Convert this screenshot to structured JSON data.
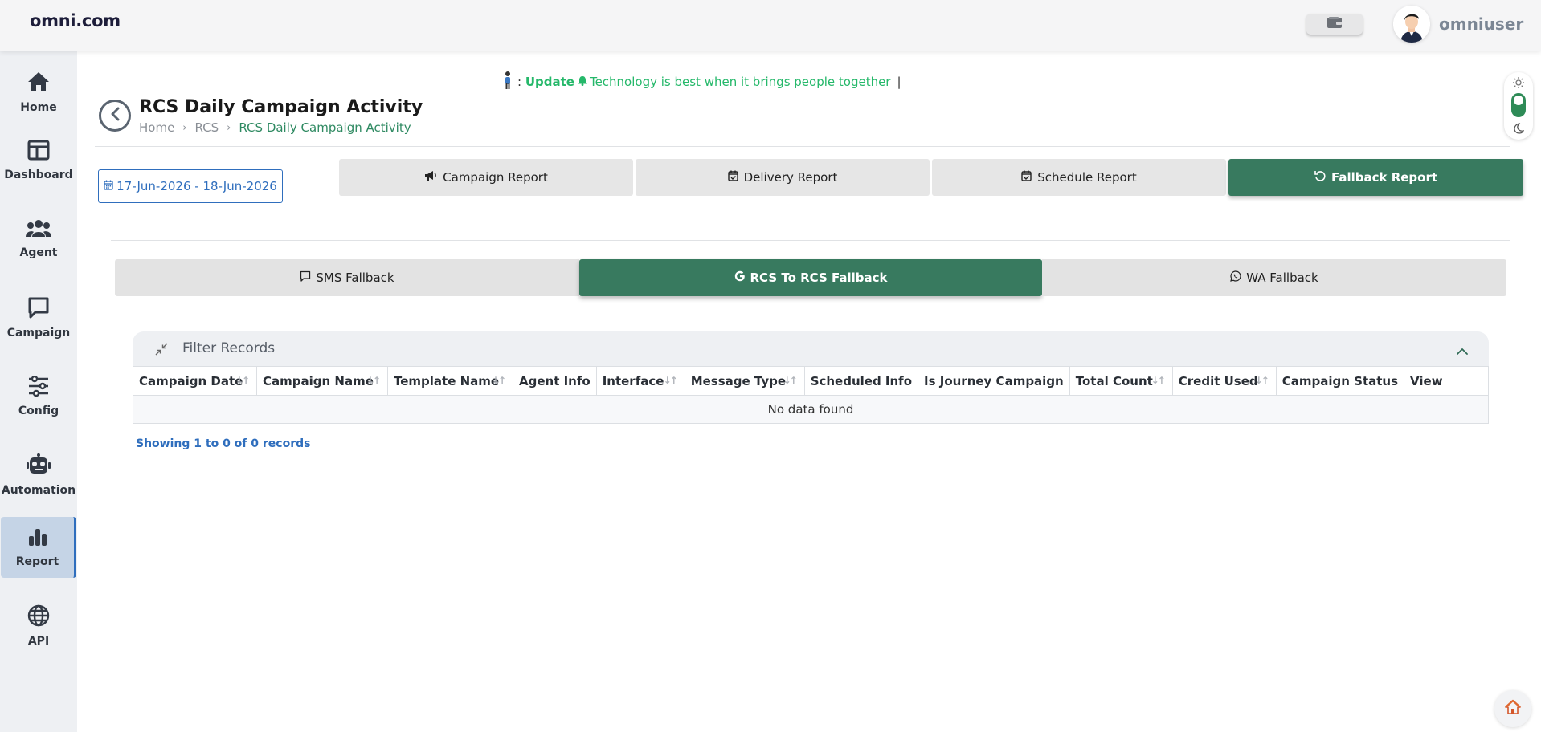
{
  "header": {
    "brand": "omni.com",
    "username": "omniuser"
  },
  "sidebar": {
    "items": [
      {
        "label": "Home",
        "icon": "home-icon"
      },
      {
        "label": "Dashboard",
        "icon": "dashboard-icon"
      },
      {
        "label": "Agent",
        "icon": "users-icon"
      },
      {
        "label": "Campaign",
        "icon": "chat-icon"
      },
      {
        "label": "Config",
        "icon": "sliders-icon"
      },
      {
        "label": "Automation",
        "icon": "robot-icon"
      },
      {
        "label": "Report",
        "icon": "bar-chart-icon",
        "active": true
      },
      {
        "label": "API",
        "icon": "globe-icon"
      }
    ]
  },
  "ticker": {
    "prefix": ": ",
    "update_label": "Update",
    "message": "Technology is best when it brings people together",
    "cursor": "|"
  },
  "page": {
    "title": "RCS Daily Campaign Activity",
    "breadcrumb": [
      "Home",
      "RCS",
      "RCS Daily Campaign Activity"
    ]
  },
  "date_range": "17-Jun-2026 - 18-Jun-2026",
  "report_tabs": [
    {
      "label": "Campaign Report",
      "icon": "megaphone-icon"
    },
    {
      "label": "Delivery Report",
      "icon": "calendar-check-icon"
    },
    {
      "label": "Schedule Report",
      "icon": "calendar-check-icon"
    },
    {
      "label": "Fallback Report",
      "icon": "undo-icon",
      "active": true
    }
  ],
  "fallback_tabs": [
    {
      "label": "SMS Fallback",
      "icon": "message-square-icon"
    },
    {
      "label": "RCS To RCS Fallback",
      "icon": "google-icon",
      "active": true
    },
    {
      "label": "WA Fallback",
      "icon": "whatsapp-icon"
    }
  ],
  "filter": {
    "title": "Filter Records"
  },
  "table": {
    "columns": [
      "Campaign Date",
      "Campaign Name",
      "Template Name",
      "Agent Info",
      "Interface",
      "Message Type",
      "Scheduled Info",
      "Is Journey Campaign",
      "Total Count",
      "Credit Used",
      "Campaign Status",
      "View"
    ],
    "empty_text": "No data found"
  },
  "records_text": "Showing 1 to 0 of 0 records",
  "colors": {
    "accent_green": "#387a5f",
    "link_blue": "#2f6ebd",
    "ticker_green": "#25b86a"
  }
}
